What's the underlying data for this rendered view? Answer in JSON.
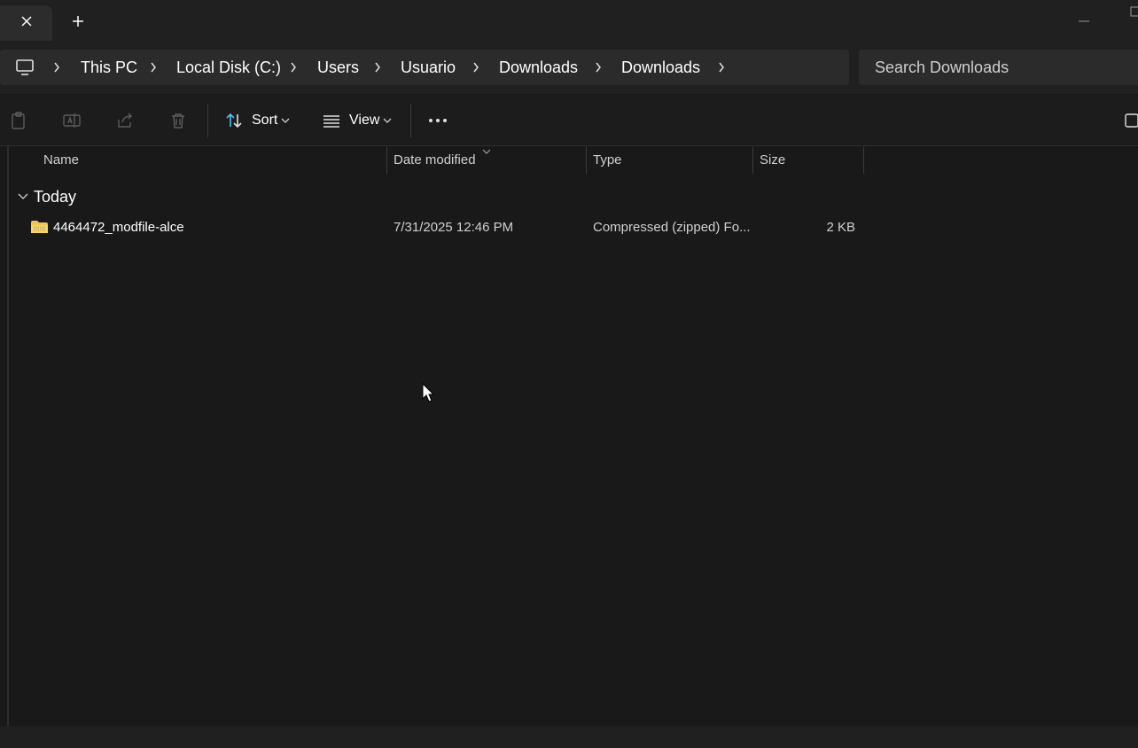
{
  "tab": {
    "close_icon": "close-icon",
    "new_tab_icon": "plus-icon"
  },
  "breadcrumbs": [
    "This PC",
    "Local Disk (C:)",
    "Users",
    "Usuario",
    "Downloads",
    "Downloads"
  ],
  "search": {
    "placeholder": "Search Downloads"
  },
  "toolbar": {
    "sort_label": "Sort",
    "view_label": "View",
    "icons": [
      "paste-icon",
      "rename-icon",
      "share-icon",
      "delete-icon",
      "sort-icon",
      "view-icon",
      "more-icon"
    ]
  },
  "columns": {
    "name": "Name",
    "date": "Date modified",
    "type": "Type",
    "size": "Size"
  },
  "group": {
    "label": "Today"
  },
  "files": [
    {
      "name": "4464472_modfile-alce",
      "date": "7/31/2025 12:46 PM",
      "type": "Compressed (zipped) Fo...",
      "size": "2 KB"
    }
  ],
  "colors": {
    "background": "#191919",
    "accent": "#4cc2ff",
    "folder": "#f2c64b"
  }
}
